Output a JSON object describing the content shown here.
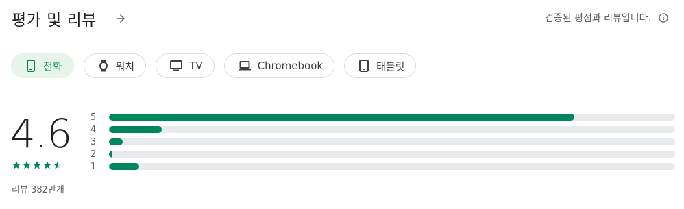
{
  "header": {
    "title": "평가 및 리뷰",
    "verified_text": "검증된 평점과 리뷰입니다."
  },
  "icons": {
    "header_arrow": "arrow-right-icon",
    "info": "info-icon"
  },
  "device_chips": [
    {
      "label": "전화",
      "icon": "phone-icon",
      "active": true
    },
    {
      "label": "워치",
      "icon": "watch-icon",
      "active": false
    },
    {
      "label": "TV",
      "icon": "tv-icon",
      "active": false
    },
    {
      "label": "Chromebook",
      "icon": "laptop-icon",
      "active": false
    },
    {
      "label": "태블릿",
      "icon": "tablet-icon",
      "active": false
    }
  ],
  "rating": {
    "score": "4.6",
    "star_level": 4.6,
    "review_count": "리뷰 382만개",
    "distribution": [
      {
        "stars": "5",
        "fraction": 0.822
      },
      {
        "stars": "4",
        "fraction": 0.093
      },
      {
        "stars": "3",
        "fraction": 0.024
      },
      {
        "stars": "2",
        "fraction": 0.006
      },
      {
        "stars": "1",
        "fraction": 0.053
      }
    ]
  },
  "colors": {
    "accent": "#01875f",
    "chip_active_bg": "#e6f4ea",
    "track": "#e8eaed"
  }
}
